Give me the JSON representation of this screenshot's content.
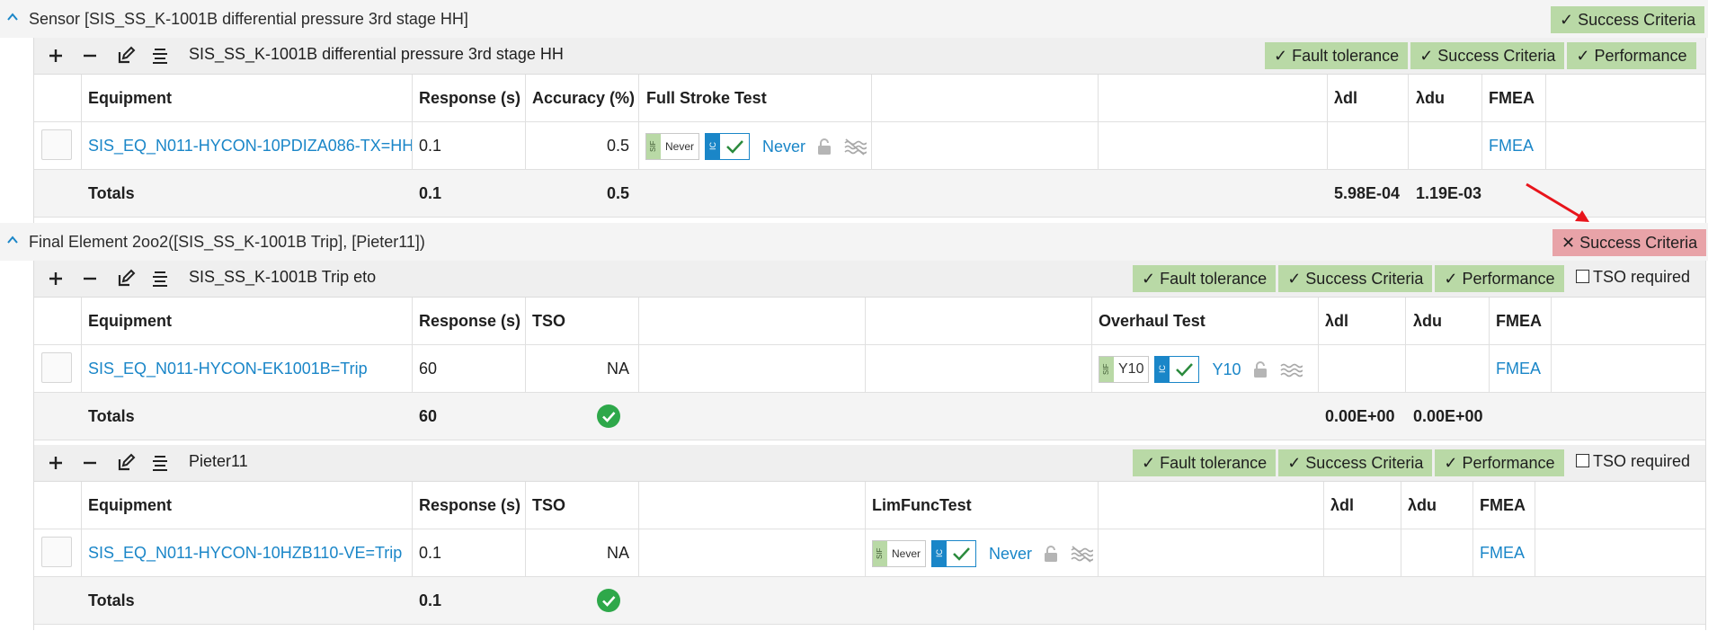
{
  "sensor_section": {
    "title": "Sensor [SIS_SS_K-1001B differential pressure 3rd stage HH]",
    "badge": "Success Criteria",
    "badge_status": "ok",
    "group": {
      "title": "SIS_SS_K-1001B differential pressure 3rd stage HH",
      "badges": [
        "Fault tolerance",
        "Success Criteria",
        "Performance"
      ],
      "headers": {
        "equipment": "Equipment",
        "response": "Response (s)",
        "accuracy": "Accuracy (%)",
        "test": "Full Stroke Test",
        "ldl": "λdl",
        "ldu": "λdu",
        "fmea": "FMEA"
      },
      "rows": [
        {
          "equipment": "SIS_EQ_N011-HYCON-10PDIZA086-TX=HH",
          "response": "0.1",
          "accuracy": "0.5",
          "sif_value": "Never",
          "sif_tag": "SIF",
          "ic_tag": "IC",
          "test_label": "Never",
          "fmea": "FMEA"
        }
      ],
      "totals": {
        "label": "Totals",
        "response": "0.1",
        "accuracy": "0.5",
        "ldl": "5.98E-04",
        "ldu": "1.19E-03"
      }
    }
  },
  "final_section": {
    "title": "Final Element 2oo2([SIS_SS_K-1001B Trip], [Pieter11])",
    "badge": "Success Criteria",
    "badge_status": "fail",
    "groups": [
      {
        "title": "SIS_SS_K-1001B Trip eto",
        "badges": [
          "Fault tolerance",
          "Success Criteria",
          "Performance"
        ],
        "tso_required": "TSO required",
        "headers": {
          "equipment": "Equipment",
          "response": "Response (s)",
          "tso": "TSO",
          "test": "Overhaul Test",
          "ldl": "λdl",
          "ldu": "λdu",
          "fmea": "FMEA"
        },
        "rows": [
          {
            "equipment": "SIS_EQ_N011-HYCON-EK1001B=Trip",
            "response": "60",
            "tso": "NA",
            "sif_value": "Y10",
            "sif_tag": "SIF",
            "ic_tag": "IC",
            "test_label": "Y10",
            "fmea": "FMEA"
          }
        ],
        "totals": {
          "label": "Totals",
          "response": "60",
          "ldl": "0.00E+00",
          "ldu": "0.00E+00"
        }
      },
      {
        "title": "Pieter11",
        "badges": [
          "Fault tolerance",
          "Success Criteria",
          "Performance"
        ],
        "tso_required": "TSO required",
        "headers": {
          "equipment": "Equipment",
          "response": "Response (s)",
          "tso": "TSO",
          "test": "LimFuncTest",
          "ldl": "λdl",
          "ldu": "λdu",
          "fmea": "FMEA"
        },
        "rows": [
          {
            "equipment": "SIS_EQ_N011-HYCON-10HZB110-VE=Trip",
            "response": "0.1",
            "tso": "NA",
            "sif_value": "Never",
            "sif_tag": "SIF",
            "ic_tag": "IC",
            "test_label": "Never",
            "fmea": "FMEA"
          }
        ],
        "totals": {
          "label": "Totals",
          "response": "0.1"
        }
      }
    ]
  },
  "icons": {
    "toolbar": [
      "plus-icon",
      "minus-icon",
      "edit-icon",
      "align-icon"
    ],
    "status_ok": "check-circle-icon",
    "annotation": "red-arrow"
  },
  "colors": {
    "ok_badge": "#b9d9a6",
    "fail_badge": "#e8a3a8",
    "link": "#1a86c8",
    "green_ok": "#2ea84a",
    "arrow": "#e8141b"
  }
}
